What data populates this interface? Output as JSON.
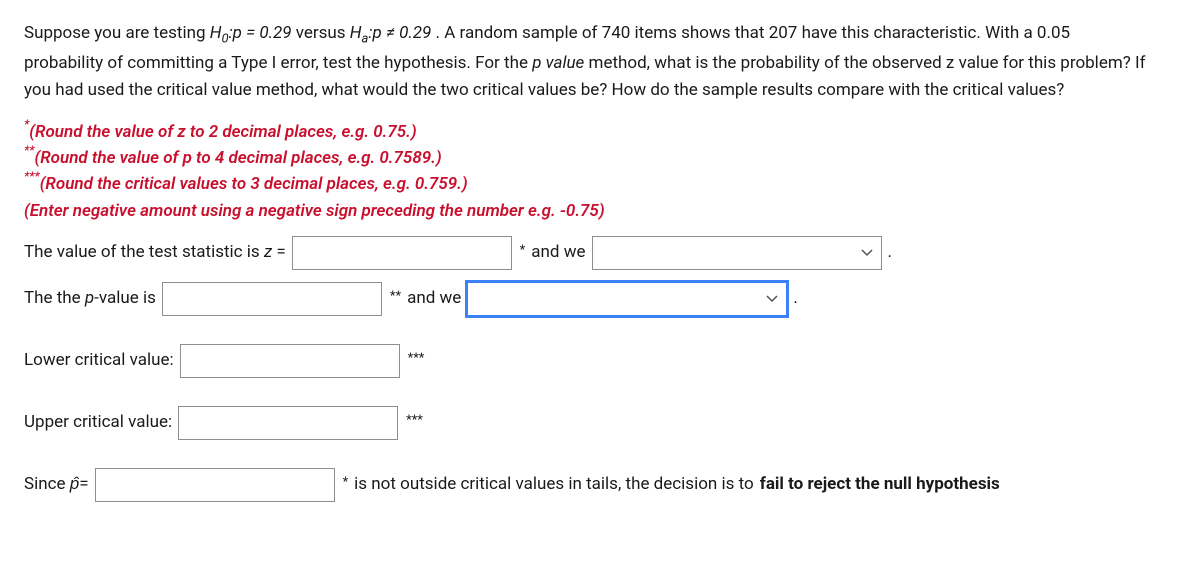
{
  "problem": {
    "sentence_part1": "Suppose you are testing ",
    "h0_label": "H",
    "h0_sub": "0",
    "h0_expr": ":p = 0.29",
    "versus": " versus ",
    "ha_label": "H",
    "ha_sub": "a",
    "ha_expr": ":p ≠ 0.29",
    "sentence_part2": " . A random sample of 740 items shows that 207 have this characteristic. With a 0.05 probability of committing a Type I error, test the hypothesis. For the ",
    "pvalue_word": "p value",
    "sentence_part3": " method, what is the probability of the observed z value for this problem? If you had used the critical value method, what would the two critical values be? How do the sample results compare with the critical values?"
  },
  "instructions": {
    "line1": "(Round the value of z to 2 decimal places, e.g. 0.75.)",
    "line2": "(Round the value of p to 4 decimal places, e.g. 0.7589.)",
    "line3": "(Round the critical values to 3 decimal places, e.g. 0.759.)",
    "line4": "(Enter negative amount using a negative sign preceding the number e.g. -0.75)"
  },
  "rows": {
    "z_label_pre": "The value of the test statistic is ",
    "z_symbol": "z",
    "z_equals": " = ",
    "andwe": " and we ",
    "p_label_pre": "The the ",
    "p_word": "p",
    "p_label_post": "-value is ",
    "lower_label": "Lower critical value: ",
    "upper_label": "Upper critical value: ",
    "since": "Since ",
    "phat": "p̂",
    "equals": "=",
    "conclusion_mid": " is not outside critical values in tails, the decision is to ",
    "conclusion_bold": "fail to reject the null hypothesis"
  },
  "inputs": {
    "z_value": "",
    "z_decision": "",
    "p_value": "",
    "p_decision": "",
    "lower_cv": "",
    "upper_cv": "",
    "phat_value": ""
  },
  "marks": {
    "one": "*",
    "two": "**",
    "three": "***"
  },
  "punct": {
    "period": "."
  }
}
